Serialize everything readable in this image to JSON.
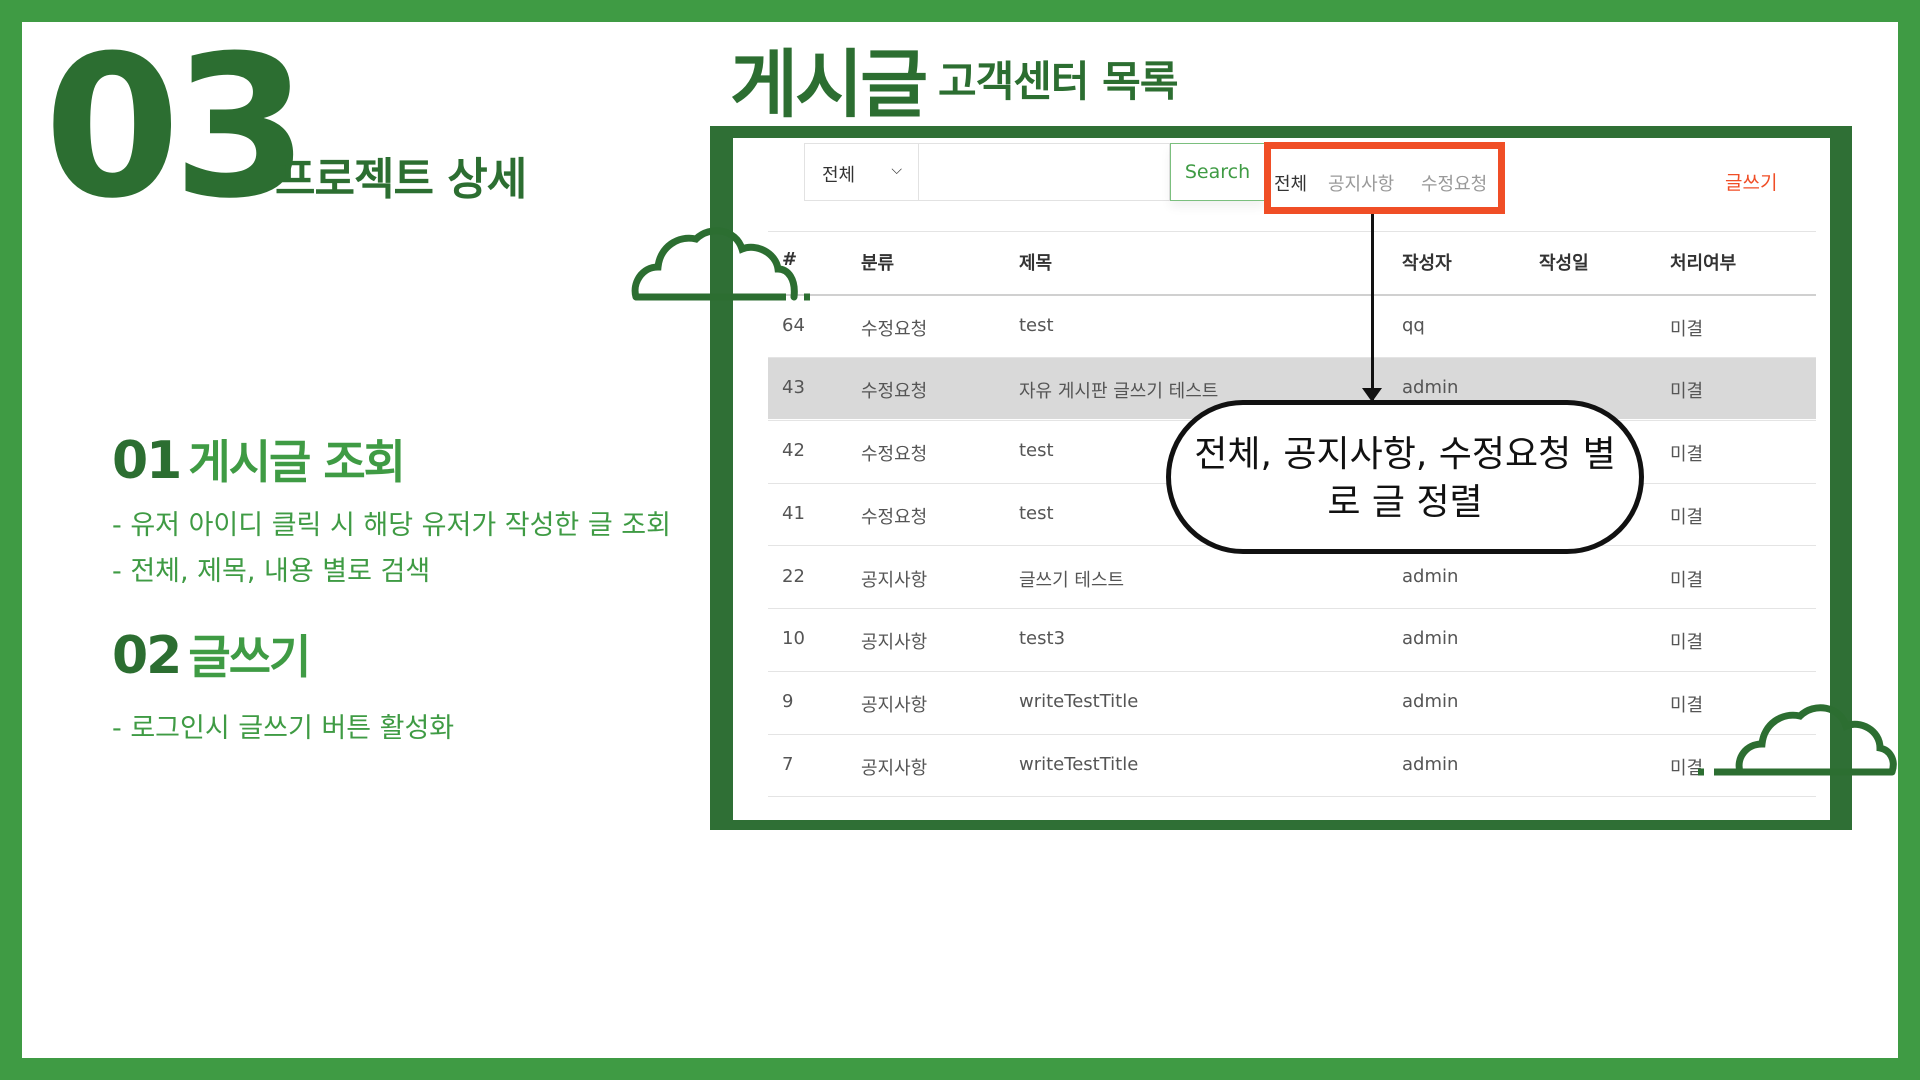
{
  "slide": {
    "section_number": "03",
    "section_title": "프로젝트 상세",
    "page_title": "게시글",
    "page_subtitle": "고객센터 목록",
    "features": [
      {
        "number": "01",
        "title": "게시글 조회",
        "lines": [
          "- 유저 아이디 클릭 시 해당 유저가 작성한 글 조회",
          "- 전체, 제목, 내용 별로 검색"
        ]
      },
      {
        "number": "02",
        "title": "글쓰기",
        "lines": [
          "- 로그인시 글쓰기 버튼 활성화"
        ]
      }
    ],
    "callout": {
      "line1": "전체, 공지사항, 수정요청 별",
      "line2": "로 글 정렬"
    }
  },
  "board": {
    "category_select": "전체",
    "search_input": "",
    "search_button": "Search",
    "filter_tabs": [
      "전체",
      "공지사항",
      "수정요청"
    ],
    "write_button": "글쓰기",
    "columns": [
      "#",
      "분류",
      "제목",
      "작성자",
      "작성일",
      "처리여부"
    ],
    "rows": [
      {
        "no": "64",
        "category": "수정요청",
        "title": "test",
        "author": "qq",
        "date": "",
        "status": "미결"
      },
      {
        "no": "43",
        "category": "수정요청",
        "title": "자유 게시판 글쓰기 테스트",
        "author": "admin",
        "date": "",
        "status": "미결"
      },
      {
        "no": "42",
        "category": "수정요청",
        "title": "test",
        "author": "",
        "date": "",
        "status": "미결"
      },
      {
        "no": "41",
        "category": "수정요청",
        "title": "test",
        "author": "",
        "date": "",
        "status": "미결"
      },
      {
        "no": "22",
        "category": "공지사항",
        "title": "글쓰기 테스트",
        "author": "admin",
        "date": "",
        "status": "미결"
      },
      {
        "no": "10",
        "category": "공지사항",
        "title": "test3",
        "author": "admin",
        "date": "",
        "status": "미결"
      },
      {
        "no": "9",
        "category": "공지사항",
        "title": "writeTestTitle",
        "author": "admin",
        "date": "",
        "status": "미결"
      },
      {
        "no": "7",
        "category": "공지사항",
        "title": "writeTestTitle",
        "author": "admin",
        "date": "",
        "status": "미결"
      }
    ]
  },
  "colors": {
    "border": "#3f9b44",
    "dark_green": "#2c6e31",
    "highlight_box": "#f04e26",
    "row_highlight": "#d9d9d9"
  }
}
